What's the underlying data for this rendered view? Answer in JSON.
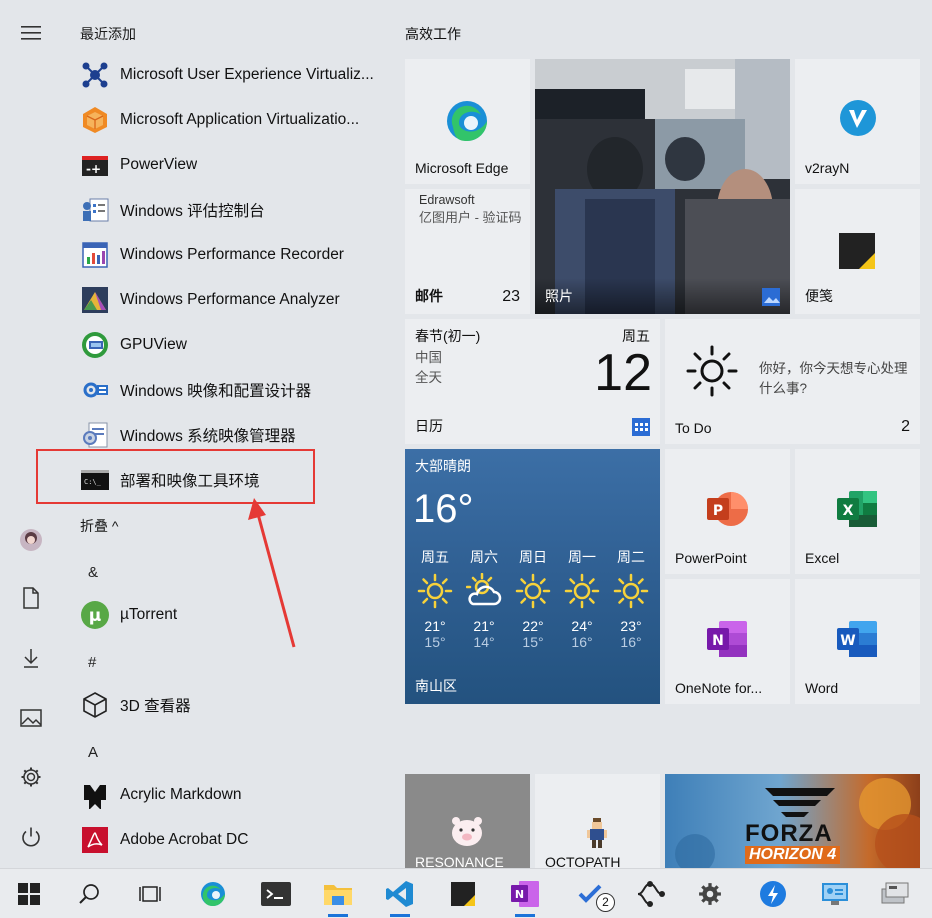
{
  "app_list": {
    "recent_header": "最近添加",
    "recent": [
      {
        "label": "Microsoft User Experience Virtualiz...",
        "icon": "uev-icon"
      },
      {
        "label": "Microsoft Application Virtualizatio...",
        "icon": "appv-icon"
      },
      {
        "label": "PowerView",
        "icon": "powerview-icon"
      },
      {
        "label": "Windows 评估控制台",
        "icon": "assessment-icon"
      },
      {
        "label": "Windows Performance Recorder",
        "icon": "wpr-icon"
      },
      {
        "label": "Windows Performance Analyzer",
        "icon": "wpa-icon"
      },
      {
        "label": "GPUView",
        "icon": "gpuview-icon"
      },
      {
        "label": "Windows 映像和配置设计器",
        "icon": "icd-icon"
      },
      {
        "label": "Windows 系统映像管理器",
        "icon": "sim-icon"
      },
      {
        "label": "部署和映像工具环境",
        "icon": "cmd-icon"
      }
    ],
    "collapse_label": "折叠 ^",
    "groups": [
      {
        "letter": "&",
        "apps": [
          {
            "label": "µTorrent",
            "icon": "utorrent-icon"
          }
        ]
      },
      {
        "letter": "#",
        "apps": [
          {
            "label": "3D 查看器",
            "icon": "3d-viewer-icon"
          }
        ]
      },
      {
        "letter": "A",
        "apps": [
          {
            "label": "Acrylic Markdown",
            "icon": "markdown-icon"
          },
          {
            "label": "Adobe Acrobat DC",
            "icon": "acrobat-icon"
          }
        ]
      }
    ]
  },
  "tiles": {
    "header": "高效工作",
    "edge": {
      "name": "Microsoft Edge"
    },
    "photos": {
      "name": "照片"
    },
    "v2rayn": {
      "name": "v2rayN"
    },
    "mail": {
      "sender": "Edrawsoft",
      "preview": "亿图用户 - 验证码",
      "name": "邮件",
      "count": "23"
    },
    "sticky": {
      "name": "便笺"
    },
    "calendar": {
      "event": "春节(初一)",
      "line2": "中国",
      "line3": "全天",
      "weekday": "周五",
      "day": "12",
      "name": "日历"
    },
    "todo": {
      "prompt": "你好，你今天想专心处理什么事?",
      "name": "To Do",
      "count": "2"
    },
    "weather": {
      "condition": "大部晴朗",
      "temp": "16°",
      "location": "南山区",
      "forecast": [
        {
          "day": "周五",
          "icon": "sun-icon",
          "high": "21°",
          "low": "15°"
        },
        {
          "day": "周六",
          "icon": "partly-cloudy-icon",
          "high": "21°",
          "low": "14°"
        },
        {
          "day": "周日",
          "icon": "sun-icon",
          "high": "22°",
          "low": "15°"
        },
        {
          "day": "周一",
          "icon": "sun-icon",
          "high": "24°",
          "low": "16°"
        },
        {
          "day": "周二",
          "icon": "sun-icon",
          "high": "23°",
          "low": "16°"
        }
      ]
    },
    "powerpoint": {
      "name": "PowerPoint"
    },
    "excel": {
      "name": "Excel"
    },
    "onenote": {
      "name": "OneNote for..."
    },
    "word": {
      "name": "Word"
    },
    "resonance": {
      "name": "RESONANCE"
    },
    "octopath": {
      "name": "OCTOPATH"
    },
    "forza": {
      "line1": "FORZA",
      "line2": "HORIZON 4"
    }
  },
  "taskbar": {
    "badge_count": "2"
  }
}
